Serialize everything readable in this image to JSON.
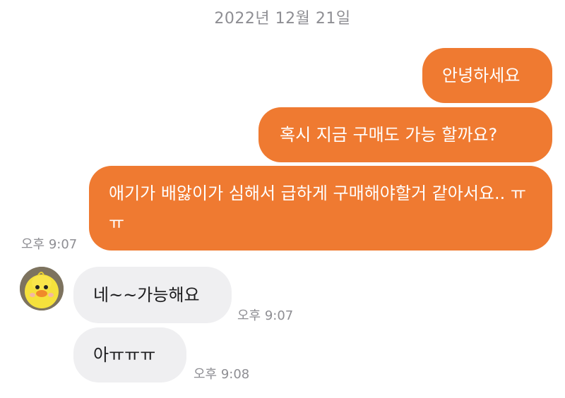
{
  "chat": {
    "date": "2022년 12월 21일",
    "messages": [
      {
        "sender": "me",
        "text": "안녕하세요"
      },
      {
        "sender": "me",
        "text": "혹시 지금 구매도 가능 할까요?"
      },
      {
        "sender": "me",
        "text": "애기가 배앓이가 심해서 급하게 구매해야할거 같아서요.. ㅠㅠ",
        "time": "오후 9:07"
      },
      {
        "sender": "other",
        "text": "네~~가능해요",
        "time": "오후 9:07"
      },
      {
        "sender": "other",
        "text": "아ㅠㅠㅠ",
        "time": "오후 9:08"
      }
    ],
    "avatar_icon": "yellow-duck-avatar",
    "colors": {
      "outgoing": "#ef7a31",
      "incoming": "#efeff1"
    }
  }
}
